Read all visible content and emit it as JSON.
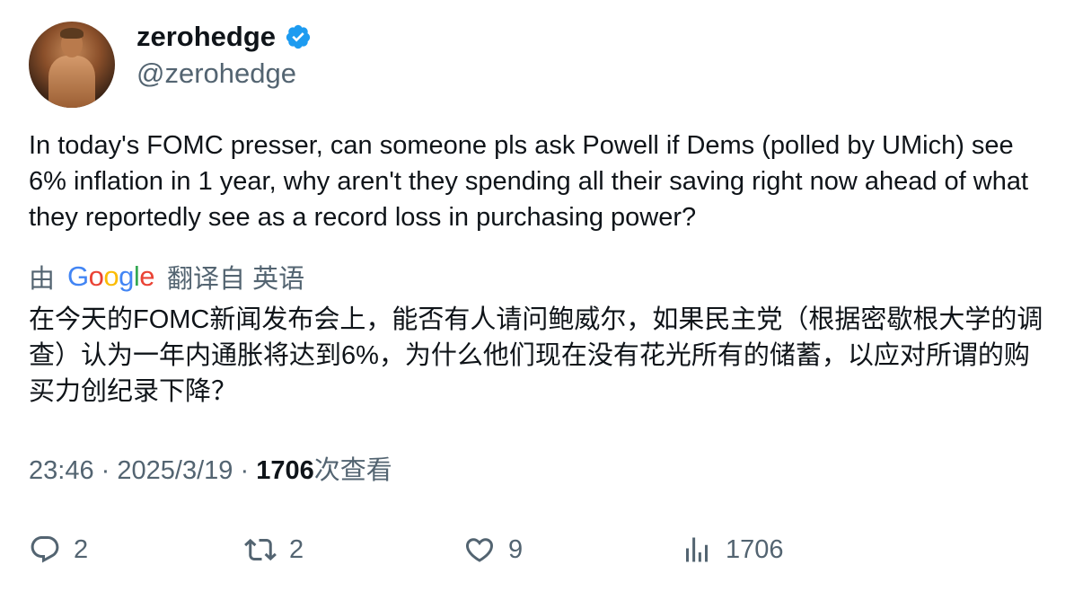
{
  "user": {
    "display_name": "zerohedge",
    "handle": "@zerohedge",
    "verified": true
  },
  "tweet": {
    "text": "In today's FOMC presser, can someone pls ask Powell if Dems (polled by UMich) see 6% inflation in 1 year, why aren't they spending all their saving right now ahead of what they reportedly see as a record loss in purchasing power?"
  },
  "translation": {
    "by_label": "由",
    "provider": "Google",
    "translated_from_label": "翻译自 英语",
    "text": "在今天的FOMC新闻发布会上，能否有人请问鲍威尔，如果民主党（根据密歇根大学的调查）认为一年内通胀将达到6%，为什么他们现在没有花光所有的储蓄，以应对所谓的购买力创纪录下降？"
  },
  "meta": {
    "time": "23:46",
    "separator": "·",
    "date": "2025/3/19",
    "views_count": "1706",
    "views_label": "次查看"
  },
  "actions": {
    "reply_count": "2",
    "retweet_count": "2",
    "like_count": "9",
    "views_count": "1706"
  },
  "colors": {
    "verified_blue": "#1d9bf0",
    "secondary_text": "#536471",
    "primary_text": "#0f1419"
  }
}
